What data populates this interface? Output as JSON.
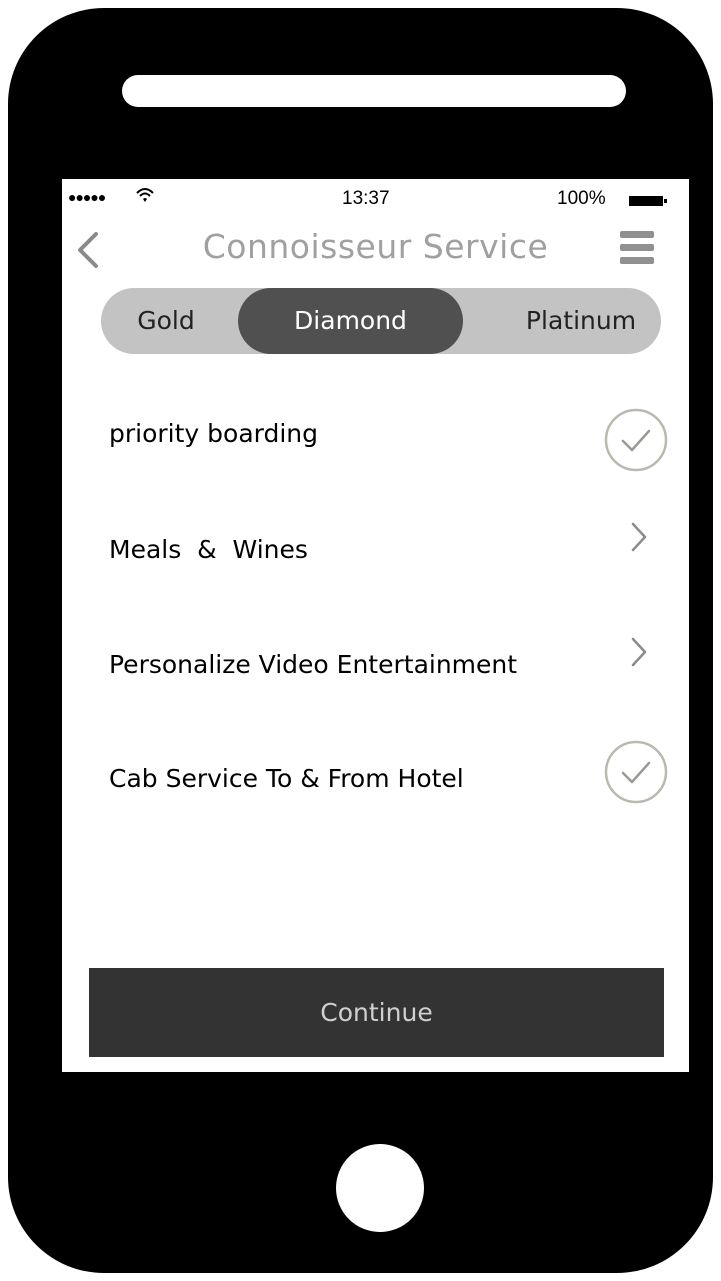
{
  "status_bar": {
    "signal": "●●●●●",
    "time": "13:37",
    "battery": "100%"
  },
  "header": {
    "title": "Connoisseur Service",
    "back_icon": "chevron-left-icon",
    "menu_icon": "hamburger-menu-icon"
  },
  "tiers": {
    "options": [
      "Gold",
      "Diamond",
      "Platinum"
    ],
    "selected": "Diamond"
  },
  "services": [
    {
      "label": "priority boarding",
      "indicator": "check-circle-icon"
    },
    {
      "label": "Meals  &  Wines",
      "indicator": "chevron-right-icon"
    },
    {
      "label": "Personalize Video Entertainment",
      "indicator": "chevron-right-icon"
    },
    {
      "label": "Cab Service To & From Hotel",
      "indicator": "check-circle-icon"
    }
  ],
  "footer": {
    "continue_label": "Continue"
  },
  "colors": {
    "frame": "#000000",
    "segment_track": "#c3c3c3",
    "segment_selected": "#505050",
    "title_text": "#a0a0a0",
    "continue_bg": "#333333"
  }
}
